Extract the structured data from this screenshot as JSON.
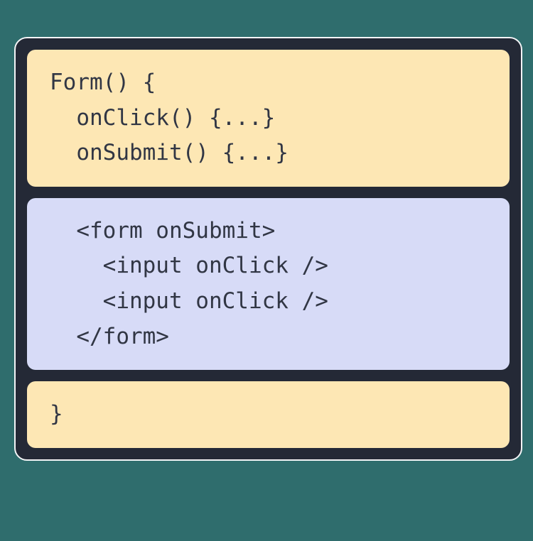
{
  "colors": {
    "frame": "#242936",
    "yellow": "#fde7b4",
    "lavender": "#d7dbf7",
    "text": "#313644",
    "page_bg": "#2f6d6d",
    "outline": "#f3f4f6"
  },
  "blocks": {
    "top": {
      "lines": [
        "Form() {",
        "  onClick() {...}",
        "  onSubmit() {...}"
      ]
    },
    "middle": {
      "lines": [
        "  <form onSubmit>",
        "    <input onClick />",
        "    <input onClick />",
        "  </form>"
      ]
    },
    "bottom": {
      "lines": [
        "}"
      ]
    }
  }
}
